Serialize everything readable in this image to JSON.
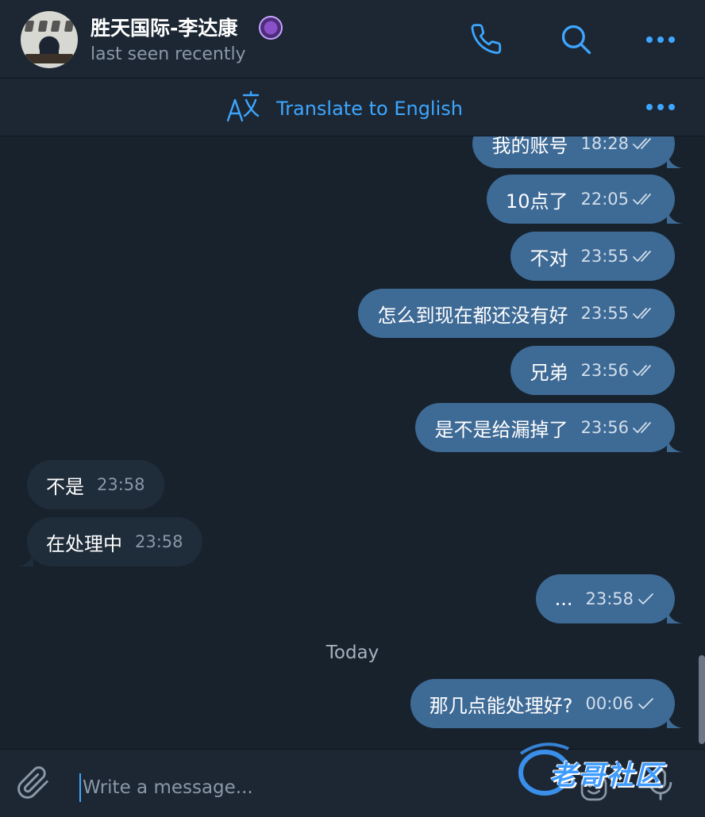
{
  "header": {
    "contact_name": "胜天国际-李达康",
    "status": "last seen recently",
    "call_icon": "phone-icon",
    "search_icon": "search-icon",
    "more_icon": "more-dots-icon"
  },
  "translate_bar": {
    "label": "Translate to English",
    "icon": "translate-icon",
    "more_icon": "more-dots-icon"
  },
  "messages": [
    {
      "direction": "out",
      "text": "我的账号",
      "time": "18:28",
      "status": "read"
    },
    {
      "direction": "out",
      "text": "10点了",
      "time": "22:05",
      "status": "read"
    },
    {
      "direction": "out",
      "text": "不对",
      "time": "23:55",
      "status": "read"
    },
    {
      "direction": "out",
      "text": "怎么到现在都还没有好",
      "time": "23:55",
      "status": "read"
    },
    {
      "direction": "out",
      "text": "兄弟",
      "time": "23:56",
      "status": "read"
    },
    {
      "direction": "out",
      "text": "是不是给漏掉了",
      "time": "23:56",
      "status": "read"
    },
    {
      "direction": "in",
      "text": "不是",
      "time": "23:58"
    },
    {
      "direction": "in",
      "text": "在处理中",
      "time": "23:58"
    },
    {
      "direction": "out",
      "text": "...",
      "time": "23:58",
      "status": "sent"
    },
    {
      "direction": "out",
      "text": "那几点能处理好?",
      "time": "00:06",
      "status": "sent"
    }
  ],
  "date_separator": "Today",
  "composer": {
    "placeholder": "Write a message...",
    "attach_icon": "paperclip-icon",
    "emoji_icon": "emoji-icon",
    "mic_icon": "microphone-icon"
  },
  "watermark": {
    "text": "老哥社区"
  },
  "colors": {
    "background": "#18222d",
    "header": "#1c2733",
    "outgoing_bubble": "#3e6a96",
    "incoming_bubble": "#1f2c3a",
    "accent": "#3ea6ff"
  }
}
